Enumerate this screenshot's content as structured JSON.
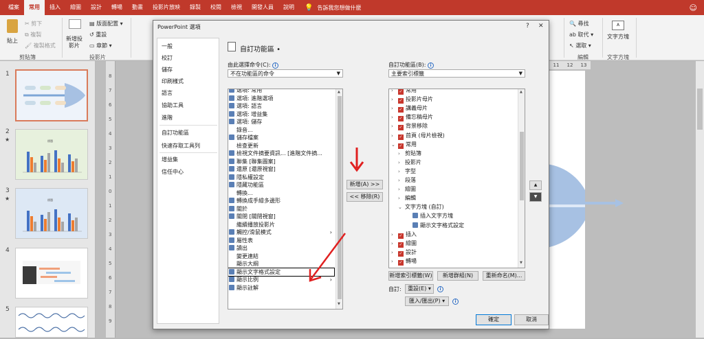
{
  "tabs": [
    "檔案",
    "常用",
    "插入",
    "繪圖",
    "設計",
    "轉場",
    "動畫",
    "投影片放映",
    "錄製",
    "校閱",
    "檢視",
    "開發人員",
    "說明"
  ],
  "tell_me": "告訴我您想做什麼",
  "ribbon": {
    "paste": "貼上",
    "cut": "剪下",
    "copy": "複製",
    "format_painter": "複製格式",
    "clipboard": "剪貼簿",
    "new_slide": "新增投影片",
    "layout": "版面配置",
    "reset": "重設",
    "section": "章節",
    "slides": "投影片",
    "find": "尋找",
    "replace": "取代",
    "select": "選取",
    "editing": "編輯",
    "textbox": "文字方塊",
    "textbox_group": "文字方塊",
    "ruler_nums": [
      "11",
      "12",
      "13"
    ]
  },
  "thumbnails": [
    {
      "num": "1",
      "star": ""
    },
    {
      "num": "2",
      "star": "★"
    },
    {
      "num": "3",
      "star": "★"
    },
    {
      "num": "4",
      "star": ""
    },
    {
      "num": "5",
      "star": ""
    }
  ],
  "thumb_chart_title": "標題",
  "ruler_marks": [
    "8",
    "7",
    "6",
    "5",
    "4",
    "3",
    "2",
    "1",
    "0",
    "1",
    "2",
    "3",
    "4",
    "5",
    "6",
    "7",
    "8",
    "9"
  ],
  "dialog": {
    "title": "PowerPoint 選項",
    "help": "?",
    "close": "✕",
    "nav": [
      "一般",
      "校訂",
      "儲存",
      "印刷樣式",
      "語言",
      "協助工具",
      "進階",
      "自訂功能區",
      "快速存取工具列",
      "增益集",
      "信任中心"
    ],
    "heading": "自訂功能區",
    "choose_label": "由此選擇命令(C):",
    "choose_value": "不在功能區的命令",
    "customize_label": "自訂功能區(B):",
    "customize_value": "主要索引標籤",
    "left_items": [
      "選項: 常用",
      "選項: 進階選項",
      "選項: 語言",
      "選項: 增益集",
      "選項: 儲存",
      "錄音...",
      "儲存檔案",
      "檢查更新",
      "檢視文件摘要資訊... [進階文件摘...",
      "聯集 [聯集圖案]",
      "還原 [還原視窗]",
      "隱私權設定",
      "隱藏功能區",
      "轉換...",
      "轉換成手繪多邊形",
      "關於",
      "關閉 [關閉視窗]",
      "繼續播放投影片",
      "觸控/滑鼠模式",
      "屬性表",
      "讀出",
      "變更連結",
      "顯示大綱",
      "顯示文字格式設定",
      "顯示比例",
      "顯示註解"
    ],
    "right_items": [
      "常用",
      "投影片母片",
      "講義母片",
      "備忘稿母片",
      "背景移除",
      "首頁 (母片檢視)",
      "常用",
      "剪貼簿",
      "投影片",
      "字型",
      "段落",
      "繪圖",
      "編輯",
      "文字方塊 (自訂)",
      "插入文字方塊",
      "顯示文字格式設定",
      "插入",
      "繪圖",
      "設計",
      "轉場"
    ],
    "add_btn": "新增(A) >>",
    "remove_btn": "<< 移除(R)",
    "up_btn": "▲",
    "down_btn": "▼",
    "new_tab_btn": "新增索引標籤(W)",
    "new_group_btn": "新增群組(N)",
    "rename_btn": "重新命名(M)...",
    "customize_label2": "自訂:",
    "reset_btn": "重設(E) ▾",
    "import_btn": "匯入/匯出(P) ▾",
    "ok_btn": "確定",
    "cancel_btn": "取消"
  }
}
